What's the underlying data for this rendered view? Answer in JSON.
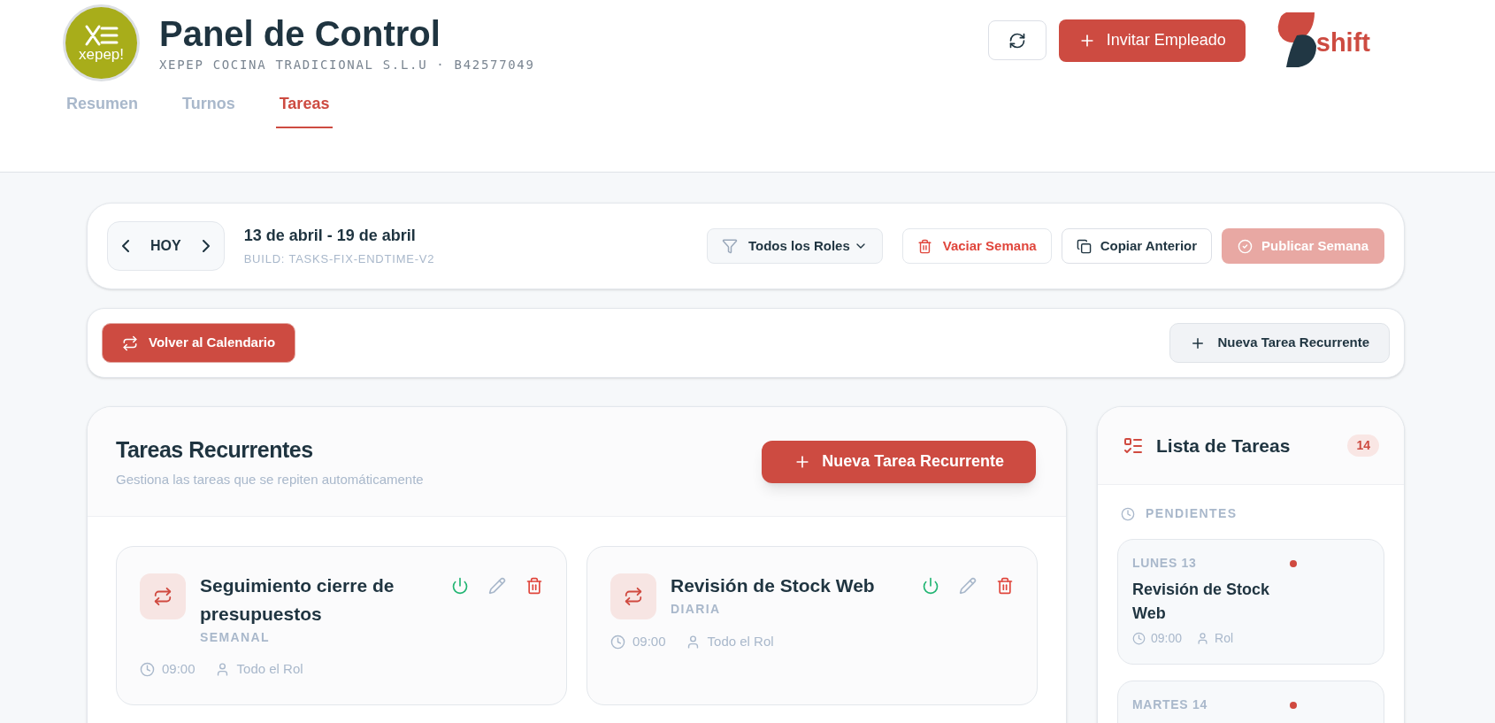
{
  "header": {
    "logo_text": "xepep!",
    "title": "Panel de Control",
    "subtitle": "XEPEP COCINA TRADICIONAL S.L.U · B42577049",
    "invite_button": "Invitar Empleado",
    "brand": "shift"
  },
  "tabs": [
    {
      "label": "Resumen",
      "selected": false
    },
    {
      "label": "Turnos",
      "selected": false
    },
    {
      "label": "Tareas",
      "selected": true
    }
  ],
  "week_bar": {
    "today": "HOY",
    "range": "13 de abril - 19 de abril",
    "build": "BUILD: TASKS-FIX-ENDTIME-V2",
    "role_filter": "Todos los Roles",
    "clear_button": "Vaciar Semana",
    "copy_button": "Copiar Anterior",
    "publish_button": {
      "label": "Publicar Semana",
      "disabled": true
    }
  },
  "action_bar": {
    "back_button": "Volver al Calendario",
    "new_button": "Nueva Tarea Recurrente"
  },
  "recurring": {
    "title": "Tareas Recurrentes",
    "subtitle": "Gestiona las tareas que se repiten automáticamente",
    "new_button": "Nueva Tarea Recurrente",
    "tasks": [
      {
        "title": "Seguimiento cierre de presupuestos",
        "frequency": "SEMANAL",
        "time": "09:00",
        "assignee": "Todo el Rol",
        "active": true
      },
      {
        "title": "Revisión de Stock Web",
        "frequency": "DIARIA",
        "time": "09:00",
        "assignee": "Todo el Rol",
        "active": true
      }
    ]
  },
  "task_list": {
    "title": "Lista de Tareas",
    "count": "14",
    "section": "PENDIENTES",
    "items": [
      {
        "day": "LUNES 13",
        "title": "Revisión de Stock Web",
        "time": "09:00",
        "role": "Rol",
        "color": "#d04a40"
      },
      {
        "day": "MARTES 14",
        "color": "#d04a40"
      }
    ]
  }
}
